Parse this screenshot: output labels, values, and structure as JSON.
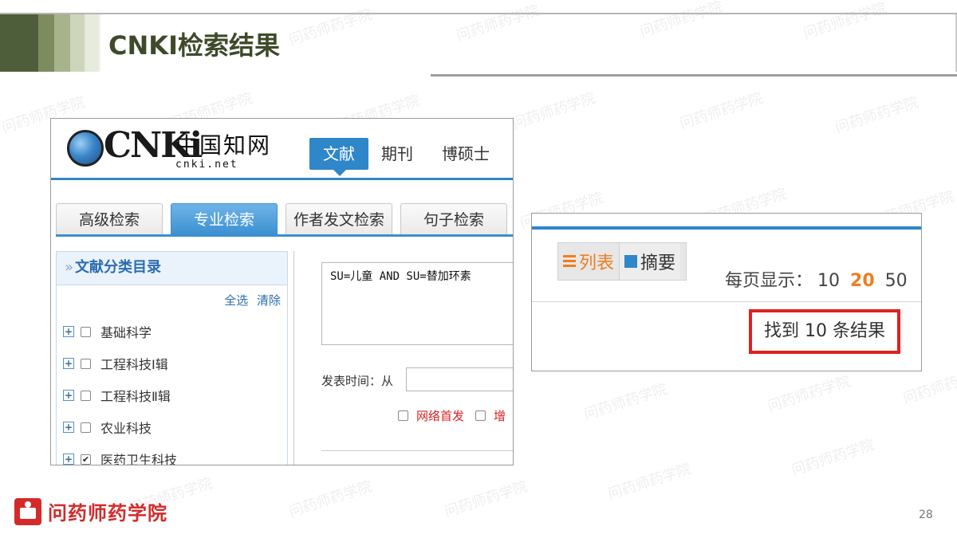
{
  "slide": {
    "title": "CNKI检索结果",
    "page_number": "28",
    "footer_brand": "问药师药学院",
    "watermark": "问药师药学院"
  },
  "cnki": {
    "logo_letters": "CNKi",
    "logo_cn": "中国知网",
    "logo_url": "cnki.net",
    "nav_tabs": [
      "文献",
      "期刊",
      "博硕士"
    ],
    "search_tabs": [
      "高级检索",
      "专业检索",
      "作者发文检索",
      "句子检索"
    ],
    "category": {
      "header_prefix": "»",
      "header": "文献分类目录",
      "select_all": "全选",
      "clear": "清除",
      "items": [
        {
          "label": "基础科学",
          "checked": false
        },
        {
          "label": "工程科技Ⅰ辑",
          "checked": false
        },
        {
          "label": "工程科技Ⅱ辑",
          "checked": false
        },
        {
          "label": "农业科技",
          "checked": false
        },
        {
          "label": "医药卫生科技",
          "checked": true
        }
      ]
    },
    "query": "SU=儿童 AND SU=替加环素",
    "time_label": "发表时间：从",
    "options": [
      "网络首发",
      "增"
    ]
  },
  "results": {
    "view_list": "列表",
    "view_abstract": "摘要",
    "per_page_label": "每页显示：",
    "per_page_options": [
      "10",
      "20",
      "50"
    ],
    "per_page_selected": "20",
    "result_text": "找到 10 条结果"
  },
  "colors": {
    "accent_blue": "#2f86c9",
    "highlight_orange": "#ef7d1f",
    "result_border_red": "#e02020",
    "title_green": "#3f4a2a",
    "brand_red": "#d42a2a"
  },
  "icons": [
    "plus-icon",
    "checkbox-icon",
    "list-icon",
    "abstract-icon",
    "cap-icon"
  ]
}
